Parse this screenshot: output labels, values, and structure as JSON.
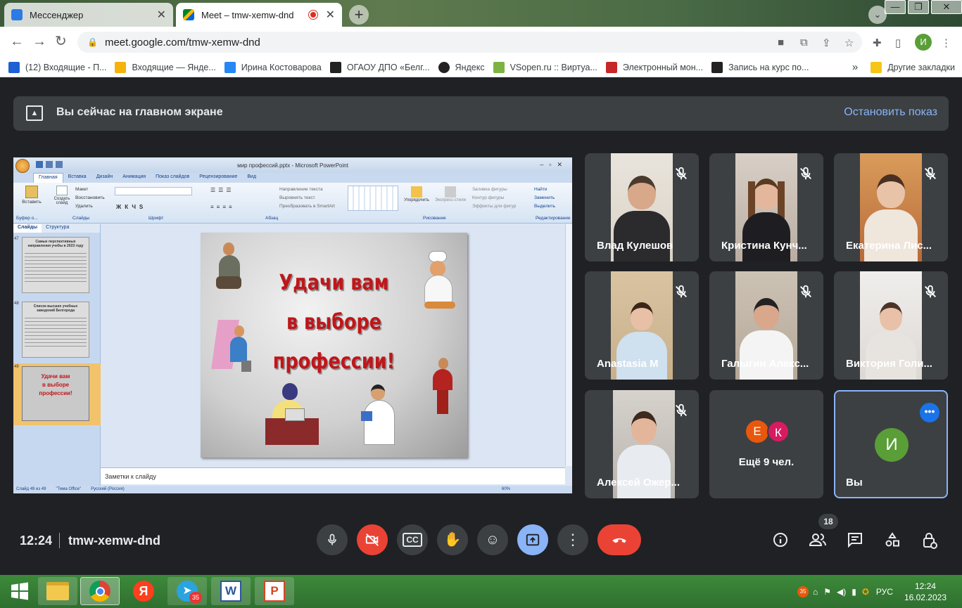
{
  "browser": {
    "tabs": [
      {
        "label": "Мессенджер",
        "active": false
      },
      {
        "label": "Meet – tmw-xemw-dnd",
        "active": true
      }
    ],
    "url": "meet.google.com/tmw-xemw-dnd",
    "profile_initial": "И",
    "bookmarks": [
      {
        "label": "(12) Входящие - П..."
      },
      {
        "label": "Входящие — Янде..."
      },
      {
        "label": "Ирина Костоварова"
      },
      {
        "label": "ОГАОУ ДПО «Белг..."
      },
      {
        "label": "Яндекс"
      },
      {
        "label": "VSopen.ru :: Виртуа..."
      },
      {
        "label": "Электронный мон..."
      },
      {
        "label": "Запись на курс по..."
      }
    ],
    "other_bookmarks": "Другие закладки",
    "more_bookmarks": "»"
  },
  "meet": {
    "banner": {
      "text": "Вы сейчас на главном экране",
      "stop_label": "Остановить показ"
    },
    "participants": [
      {
        "name": "Влад Кулешов",
        "muted": true
      },
      {
        "name": "Кристина Кунч...",
        "muted": true
      },
      {
        "name": "Екатерина Лис...",
        "muted": true
      },
      {
        "name": "Anastasia M",
        "muted": true
      },
      {
        "name": "Галыгин Алекс...",
        "muted": true
      },
      {
        "name": "Виктория Голи...",
        "muted": true
      },
      {
        "name": "Алексей Ожер...",
        "muted": true
      }
    ],
    "more_tile": {
      "initials": [
        "Е",
        "К"
      ],
      "label": "Ещё 9 чел."
    },
    "self_tile": {
      "initial": "И",
      "label": "Вы"
    },
    "time": "12:24",
    "meeting_code": "tmw-xemw-dnd",
    "participant_count": "18"
  },
  "ppt": {
    "title": "мир профессий.pptx - Microsoft PowerPoint",
    "ribbon_tabs": [
      "Главная",
      "Вставка",
      "Дизайн",
      "Анимация",
      "Показ слайдов",
      "Рецензирование",
      "Вид"
    ],
    "groups": [
      "Буфер о...",
      "Слайды",
      "Шрифт",
      "Абзац",
      "Рисование",
      "Редактирование"
    ],
    "buttons": {
      "paste": "Вставить",
      "create_slide": "Создать слайд",
      "layout": "Макет",
      "restore": "Восстановить",
      "delete": "Удалить",
      "text_direction": "Направление текста",
      "align_text": "Выровнять текст",
      "smartart": "Преобразовать в SmartArt",
      "arrange": "Упорядочить",
      "quick_styles": "Экспресс-стили",
      "shape_fill": "Заливка фигуры",
      "shape_outline": "Контур фигуры",
      "shape_effects": "Эффекты для фигур",
      "find": "Найти",
      "replace": "Заменить",
      "select": "Выделить"
    },
    "panel_tabs": [
      "Слайды",
      "Структура"
    ],
    "slide_numbers": [
      "47",
      "48",
      "49"
    ],
    "thumb1_title": "Самые перспективные направления учебы в 2023 году",
    "thumb2_title": "Список высших учебных заведений Белгорода",
    "slide_text": [
      "Удачи вам",
      "в выборе",
      "профессии!"
    ],
    "notes_placeholder": "Заметки к слайду",
    "status": {
      "slide": "Слайд 49 из 49",
      "theme": "\"Тема Office\"",
      "lang": "Русский (Россия)",
      "zoom": "60%"
    }
  },
  "taskbar": {
    "apps": [
      "windows-start",
      "file-explorer",
      "chrome",
      "yandex",
      "telegram",
      "word",
      "powerpoint"
    ],
    "telegram_badge": "35",
    "tray_badge": "35",
    "lang": "РУС",
    "time": "12:24",
    "date": "16.02.2023"
  }
}
